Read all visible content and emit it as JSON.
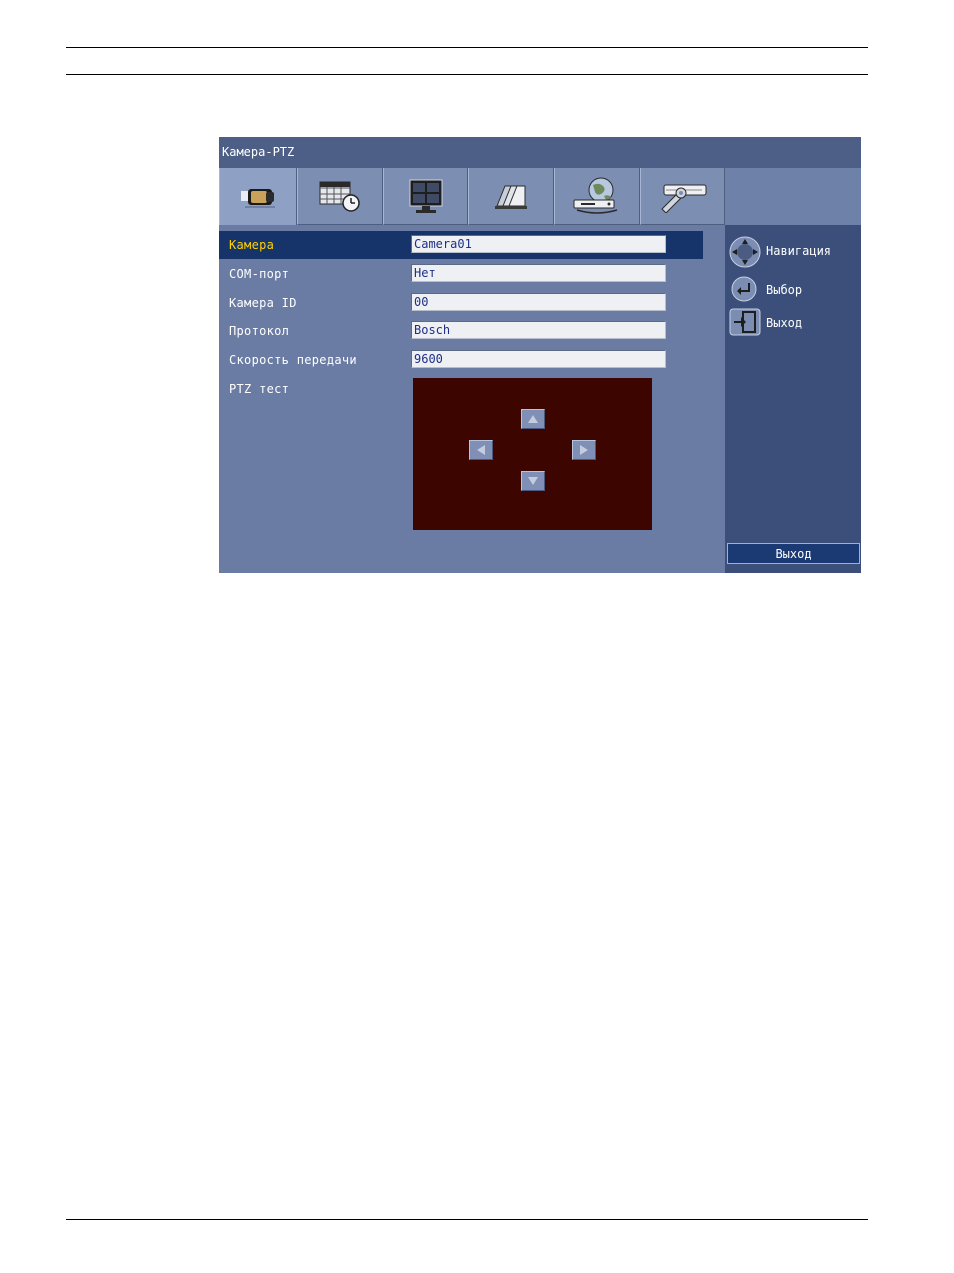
{
  "window": {
    "title": "Камера-PTZ"
  },
  "tabs": [
    {
      "icon": "camera-icon",
      "active": true
    },
    {
      "icon": "schedule-icon",
      "active": false
    },
    {
      "icon": "monitor-icon",
      "active": false
    },
    {
      "icon": "archive-icon",
      "active": false
    },
    {
      "icon": "network-icon",
      "active": false
    },
    {
      "icon": "tools-icon",
      "active": false
    }
  ],
  "settings": {
    "camera": {
      "label": "Камера",
      "value": "Camera01"
    },
    "com_port": {
      "label": "COM-порт",
      "value": "Нет"
    },
    "camera_id": {
      "label": "Камера ID",
      "value": "00"
    },
    "protocol": {
      "label": "Протокол",
      "value": "Bosch"
    },
    "baud_rate": {
      "label": "Скорость передачи",
      "value": "9600"
    },
    "ptz_test": {
      "label": "PTZ тест"
    }
  },
  "hints": [
    {
      "icon": "navigation-icon",
      "label": "Навигация"
    },
    {
      "icon": "enter-icon",
      "label": "Выбор"
    },
    {
      "icon": "exit-icon",
      "label": "Выход"
    }
  ],
  "footer": {
    "exit_label": "Выход"
  },
  "colors": {
    "screen_bg": "#6a7ca3",
    "title_bar": "#4d5f86",
    "selected_row": "#16336a",
    "selected_text": "#ffd200",
    "field_text": "#1d2f88",
    "ptz_area": "#3d0500",
    "side_panel": "#3c4f7b"
  }
}
